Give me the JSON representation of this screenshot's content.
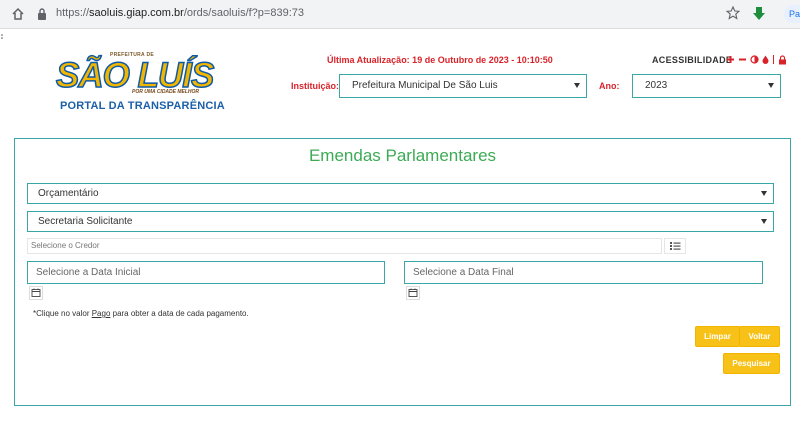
{
  "browser": {
    "url_scheme": "https://",
    "url_host": "saoluis.giap.com.br",
    "url_path": "/ords/saoluis/f?p=839:73",
    "profile_label": "Paused"
  },
  "header": {
    "logo": {
      "prefix": "PREFEITURA DE",
      "title": "SÃO LUÍS",
      "slogan": "POR UMA CIDADE MELHOR",
      "portal": "PORTAL DA TRANSPARÊNCIA"
    },
    "last_update": "Última Atualização: 19 de Outubro de 2023 - 10:10:50",
    "accessibility_label": "ACESSIBILIDADE",
    "accessibility_icons": [
      "increase-font-icon",
      "decrease-font-icon",
      "contrast-icon",
      "water-drop-icon",
      "accessibility-lock-icon"
    ],
    "institution_label": "Instituição:",
    "institution_value": "Prefeitura Municipal De São Luis",
    "year_label": "Ano:",
    "year_value": "2023"
  },
  "form": {
    "title": "Emendas Parlamentares",
    "type_value": "Orçamentário",
    "secretaria_value": "Secretaria Solicitante",
    "credor_placeholder": "Selecione o Credor",
    "date_start_placeholder": "Selecione a Data Inicial",
    "date_end_placeholder": "Selecione a Data Final",
    "note_prefix": "*Clique no valor ",
    "note_link": "Pago",
    "note_suffix": " para obter a data de cada pagamento.",
    "buttons": {
      "clear": "Limpar",
      "back": "Voltar",
      "search": "Pesquisar"
    }
  },
  "colors": {
    "accent_red": "#d9232a",
    "title_green": "#3dab55",
    "border_teal": "#3aa6a6",
    "button_yellow": "#f7c117"
  }
}
